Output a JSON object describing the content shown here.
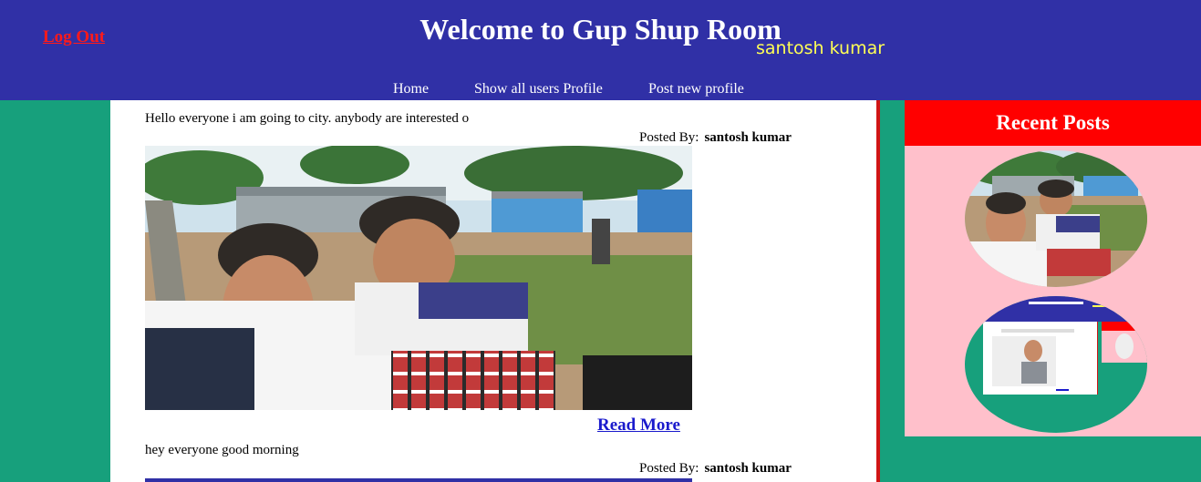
{
  "header": {
    "logout_label": "Log Out",
    "title": "Welcome to Gup Shup Room",
    "user_name": "santosh kumar"
  },
  "nav": {
    "items": [
      {
        "label": "Home"
      },
      {
        "label": "Show all users Profile"
      },
      {
        "label": "Post new profile"
      }
    ]
  },
  "posts": [
    {
      "text": "Hello everyone i am going to city. anybody are interested o",
      "posted_by_label": "Posted By:",
      "author": "santosh kumar",
      "read_more_label": "Read More"
    },
    {
      "text": "hey everyone good morning",
      "posted_by_label": "Posted By:",
      "author": "santosh kumar"
    }
  ],
  "sidebar": {
    "title": "Recent Posts"
  },
  "colors": {
    "header_bg": "#3030a6",
    "page_bg": "#17a07c",
    "logout": "#ff1a1a",
    "user_name": "#ffff55",
    "sidebar_bg": "#ffc0cb",
    "sidebar_header_bg": "#ff0000",
    "link": "#1a1acc"
  }
}
